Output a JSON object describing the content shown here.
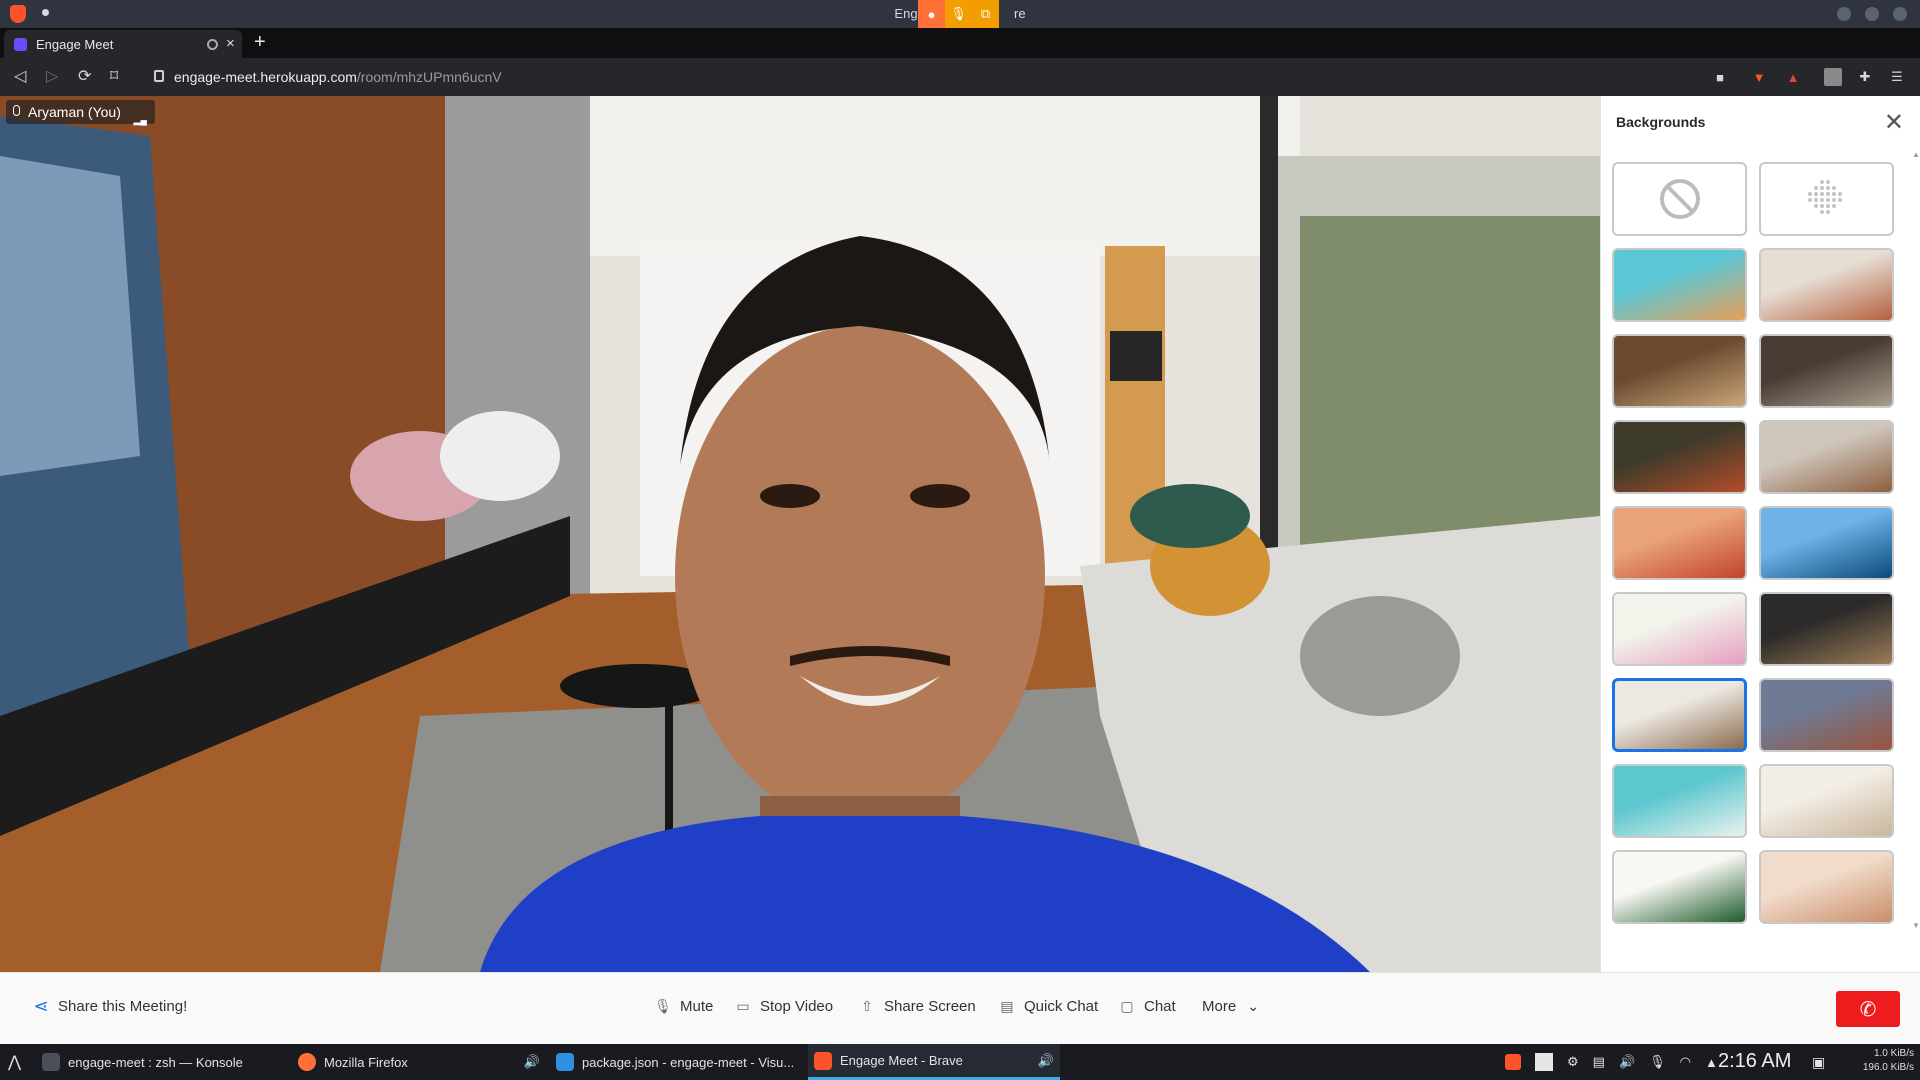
{
  "window": {
    "title_left": "Engag",
    "title_right": "re"
  },
  "browser": {
    "tab_title": "Engage Meet",
    "tab_close": "×",
    "new_tab": "+",
    "url_domain": "engage-meet.herokuapp.com",
    "url_path": "/room/mhzUPmn6ucnV"
  },
  "video": {
    "participant_name": "Aryaman (You)"
  },
  "panel": {
    "title": "Backgrounds",
    "close": "✕",
    "thumbnails": [
      {
        "name": "none",
        "kind": "none-icon"
      },
      {
        "name": "blur",
        "kind": "blur-icon"
      },
      {
        "name": "paint-splash",
        "colors": [
          "#5cc7d4",
          "#e79e58"
        ]
      },
      {
        "name": "cozy-living-room",
        "colors": [
          "#e6ddd3",
          "#b5603e"
        ]
      },
      {
        "name": "bookshelf",
        "colors": [
          "#6b4a31",
          "#cba678"
        ]
      },
      {
        "name": "cafe-interior",
        "colors": [
          "#4a3c34",
          "#a89c8c"
        ]
      },
      {
        "name": "green-wall-lounge",
        "colors": [
          "#3e3b2a",
          "#b44c2a"
        ]
      },
      {
        "name": "gallery-lounge",
        "colors": [
          "#cfc6bb",
          "#8c5f3e"
        ]
      },
      {
        "name": "desert-dune",
        "colors": [
          "#e9a279",
          "#c2442a"
        ]
      },
      {
        "name": "ocean-underwater",
        "colors": [
          "#6fb2e6",
          "#0b4a7c"
        ]
      },
      {
        "name": "flowers",
        "colors": [
          "#f2f4ec",
          "#e79fc0"
        ]
      },
      {
        "name": "dark-kitchen",
        "colors": [
          "#2c2b29",
          "#9b7b57"
        ]
      },
      {
        "name": "modern-living-room",
        "colors": [
          "#ece8e2",
          "#8b6b4d"
        ],
        "selected": true
      },
      {
        "name": "red-rocks",
        "colors": [
          "#6f7a94",
          "#99543c"
        ]
      },
      {
        "name": "tropical-beach",
        "colors": [
          "#5dc7cf",
          "#eaf2ee"
        ]
      },
      {
        "name": "white-dining-room",
        "colors": [
          "#f3eee6",
          "#c9b59b"
        ]
      },
      {
        "name": "monstera-leaf",
        "colors": [
          "#f7f7f3",
          "#1f5b2a"
        ]
      },
      {
        "name": "golden-gate-fog",
        "colors": [
          "#f1dccb",
          "#c98e6a"
        ]
      }
    ]
  },
  "controls": {
    "share_label": "Share this Meeting!",
    "mute_label": "Mute",
    "stop_video_label": "Stop Video",
    "share_screen_label": "Share Screen",
    "quick_chat_label": "Quick Chat",
    "chat_label": "Chat",
    "more_label": "More"
  },
  "taskbar": {
    "items": [
      {
        "label": "engage-meet : zsh — Konsole",
        "icon": "konsole-icon"
      },
      {
        "label": "Mozilla Firefox",
        "icon": "firefox-icon"
      },
      {
        "label": "package.json - engage-meet - Visu...",
        "icon": "vscode-icon"
      },
      {
        "label": "Engage Meet - Brave",
        "icon": "brave-icon",
        "active": true
      }
    ],
    "clock": "2:16 AM",
    "net_up": "1.0 KiB/s",
    "net_down": "196.0 KiB/s"
  },
  "colors": {
    "accent": "#1a73e8",
    "hangup": "#ee1c1c",
    "brave": "#fb542b"
  }
}
